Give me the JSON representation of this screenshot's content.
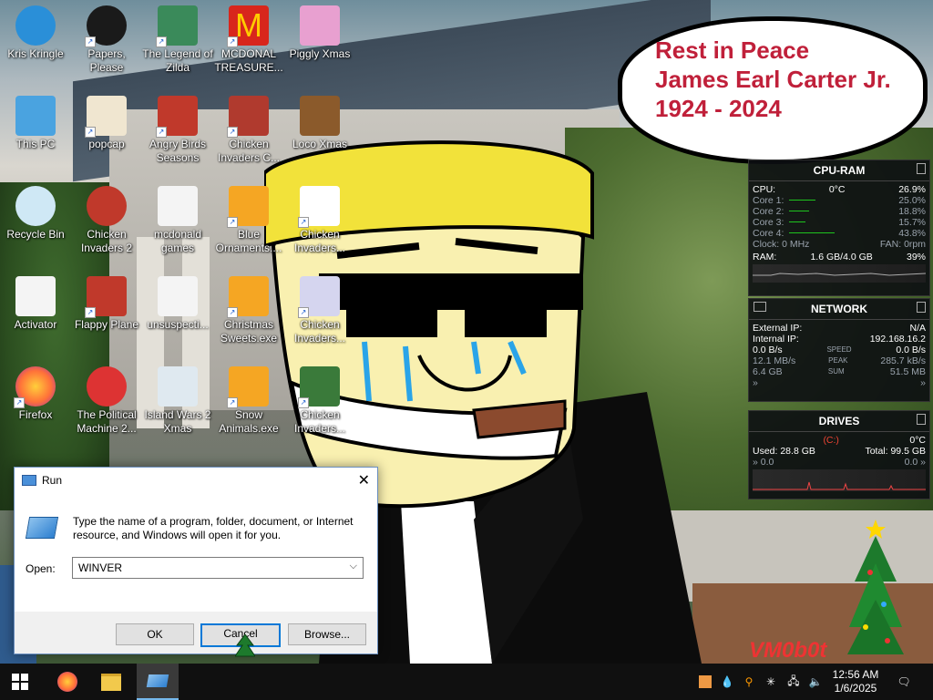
{
  "desktop": {
    "icons": [
      {
        "label": "Kris Kringle",
        "icon": "kris-kringle-icon"
      },
      {
        "label": "Papers, Please",
        "icon": "papers-please-icon"
      },
      {
        "label": "The Legend of Zilda",
        "icon": "legend-of-zilda-icon"
      },
      {
        "label": "MCDONAL TREASURE...",
        "icon": "mcdonald-treasure-icon"
      },
      {
        "label": "Piggly Xmas",
        "icon": "piggly-xmas-icon"
      },
      {
        "label": "This PC",
        "icon": "this-pc-icon"
      },
      {
        "label": "popcap",
        "icon": "popcap-icon"
      },
      {
        "label": "Angry Birds Seasons",
        "icon": "angry-birds-icon"
      },
      {
        "label": "Chicken Invaders C...",
        "icon": "chicken-invaders-c-icon"
      },
      {
        "label": "Loco Xmas",
        "icon": "loco-xmas-icon"
      },
      {
        "label": "Recycle Bin",
        "icon": "recycle-bin-icon"
      },
      {
        "label": "Chicken Invaders 2",
        "icon": "chicken-invaders-2-icon"
      },
      {
        "label": "mcdonald games",
        "icon": "folder-icon"
      },
      {
        "label": "Blue Ornaments....",
        "icon": "blue-ornaments-icon"
      },
      {
        "label": "Chicken Invaders...",
        "icon": "chicken-invaders-icon"
      },
      {
        "label": "Activator",
        "icon": "activator-icon"
      },
      {
        "label": "Flappy Plane",
        "icon": "flappy-plane-icon"
      },
      {
        "label": "unsuspecti...",
        "icon": "unsuspecting-icon"
      },
      {
        "label": "Christmas Sweets.exe",
        "icon": "christmas-sweets-icon"
      },
      {
        "label": "Chicken Invaders...",
        "icon": "chicken-invaders-icon"
      },
      {
        "label": "Firefox",
        "icon": "firefox-icon"
      },
      {
        "label": "The Political Machine 2...",
        "icon": "political-machine-icon"
      },
      {
        "label": "Island Wars 2 Xmas",
        "icon": "island-wars-icon"
      },
      {
        "label": "Snow Animals.exe",
        "icon": "snow-animals-icon"
      },
      {
        "label": "Chicken Invaders...",
        "icon": "chicken-invaders-icon"
      }
    ]
  },
  "bubble": {
    "line1": "Rest in Peace",
    "line2": "James Earl Carter Jr.",
    "line3": "1924 - 2024",
    "color": "#c0203a"
  },
  "widget_cpu": {
    "title": "CPU-RAM",
    "cpu_label": "CPU:",
    "cpu_temp": "0°C",
    "cpu_value": "26.9%",
    "cores": [
      {
        "label": "Core 1:",
        "value": "25.0%",
        "level": 0.25
      },
      {
        "label": "Core 2:",
        "value": "18.8%",
        "level": 0.188
      },
      {
        "label": "Core 3:",
        "value": "15.7%",
        "level": 0.157
      },
      {
        "label": "Core 4:",
        "value": "43.8%",
        "level": 0.438
      }
    ],
    "clock_label": "Clock: 0 MHz",
    "fan_label": "FAN: 0rpm",
    "ram_label": "RAM:",
    "ram_value": "1.6 GB/4.0 GB",
    "ram_percent": "39%"
  },
  "widget_net": {
    "title": "NETWORK",
    "external_label": "External IP:",
    "external_value": "N/A",
    "internal_label": "Internal IP:",
    "internal_value": "192.168.16.2",
    "speed_left": "0.0 B/s",
    "speed_tag": "SPEED",
    "speed_right": "0.0 B/s",
    "peak_left": "12.1 MB/s",
    "peak_tag": "PEAK",
    "peak_right": "285.7 kB/s",
    "sum_left": "6.4 GB",
    "sum_tag": "SUM",
    "sum_right": "51.5 MB"
  },
  "widget_drives": {
    "title": "DRIVES",
    "drive": "(C:)",
    "temp": "0°C",
    "used": "Used: 28.8 GB",
    "total": "Total: 99.5 GB",
    "read": "0.0",
    "write": "0.0"
  },
  "run_dialog": {
    "title": "Run",
    "description": "Type the name of a program, folder, document, or Internet resource, and Windows will open it for you.",
    "open_label": "Open:",
    "open_value": "WINVER",
    "ok_label": "OK",
    "cancel_label": "Cancel",
    "browse_label": "Browse..."
  },
  "taskbar": {
    "time": "12:56 AM",
    "date": "1/6/2025"
  },
  "watermark": "VM0b0t"
}
